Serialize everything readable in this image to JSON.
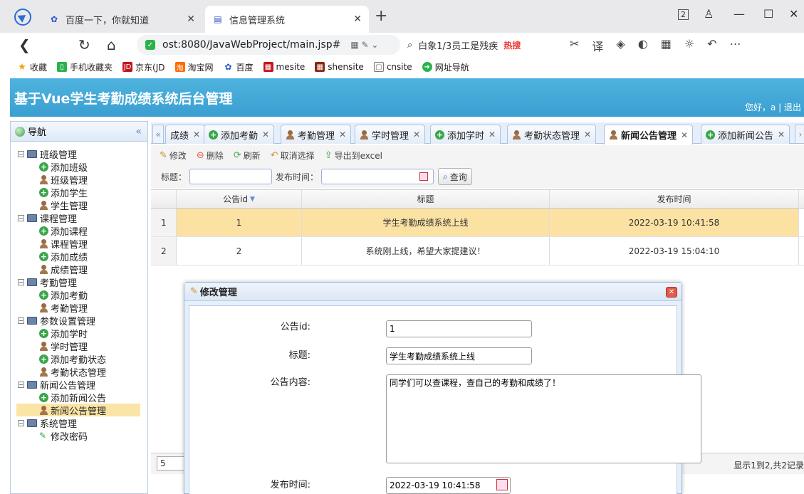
{
  "browser": {
    "tabs": [
      {
        "label": "百度一下，你就知道",
        "active": false
      },
      {
        "label": "信息管理系统",
        "active": true
      }
    ],
    "url": "ost:8080/JavaWebProject/main.jsp#",
    "search_text": "白象1/3员工是残疾",
    "hot_label": "热搜",
    "window_badge": "2",
    "bookmarks": [
      "收藏",
      "手机收藏夹",
      "京东(JD",
      "淘宝网",
      "百度",
      "mesite",
      "shensite",
      "cnsite",
      "网址导航"
    ]
  },
  "app": {
    "title": "基于Vue学生考勤成绩系统后台管理",
    "userinfo": "您好，a | 退出"
  },
  "nav": {
    "header": "导航",
    "groups": [
      {
        "label": "班级管理",
        "items": [
          {
            "label": "添加班级",
            "icon": "plus"
          },
          {
            "label": "班级管理",
            "icon": "user"
          },
          {
            "label": "添加学生",
            "icon": "plus"
          },
          {
            "label": "学生管理",
            "icon": "user"
          }
        ]
      },
      {
        "label": "课程管理",
        "items": [
          {
            "label": "添加课程",
            "icon": "plus"
          },
          {
            "label": "课程管理",
            "icon": "user"
          },
          {
            "label": "添加成绩",
            "icon": "plus"
          },
          {
            "label": "成绩管理",
            "icon": "user"
          }
        ]
      },
      {
        "label": "考勤管理",
        "items": [
          {
            "label": "添加考勤",
            "icon": "plus"
          },
          {
            "label": "考勤管理",
            "icon": "user"
          }
        ]
      },
      {
        "label": "参数设置管理",
        "items": [
          {
            "label": "添加学时",
            "icon": "plus"
          },
          {
            "label": "学时管理",
            "icon": "user"
          },
          {
            "label": "添加考勤状态",
            "icon": "plus"
          },
          {
            "label": "考勤状态管理",
            "icon": "user"
          }
        ]
      },
      {
        "label": "新闻公告管理",
        "items": [
          {
            "label": "添加新闻公告",
            "icon": "plus"
          },
          {
            "label": "新闻公告管理",
            "icon": "user",
            "selected": true
          }
        ]
      },
      {
        "label": "系统管理",
        "items": [
          {
            "label": "修改密码",
            "icon": "pen"
          }
        ]
      }
    ]
  },
  "maintabs": [
    {
      "label": "成绩",
      "icon": "none"
    },
    {
      "label": "添加考勤",
      "icon": "plus"
    },
    {
      "label": "考勤管理",
      "icon": "user"
    },
    {
      "label": "学时管理",
      "icon": "user"
    },
    {
      "label": "添加学时",
      "icon": "plus"
    },
    {
      "label": "考勤状态管理",
      "icon": "user"
    },
    {
      "label": "新闻公告管理",
      "icon": "user",
      "active": true
    },
    {
      "label": "添加新闻公告",
      "icon": "plus"
    }
  ],
  "toolbar": {
    "edit": "修改",
    "delete": "删除",
    "refresh": "刷新",
    "cancel_select": "取消选择",
    "export": "导出到excel"
  },
  "search": {
    "title_label": "标题：",
    "time_label": "发布时间：",
    "query_button": "查询"
  },
  "grid": {
    "columns": [
      "公告id",
      "标题",
      "发布时间"
    ],
    "rows": [
      {
        "num": "1",
        "id": "1",
        "title": "学生考勤成绩系统上线",
        "time": "2022-03-19 10:41:58",
        "selected": true
      },
      {
        "num": "2",
        "id": "2",
        "title": "系统刚上线，希望大家提建议！",
        "time": "2022-03-19 15:04:10",
        "selected": false
      }
    ]
  },
  "pager": {
    "page_size": "5",
    "info": "显示1到2,共2记录"
  },
  "modal": {
    "title": "修改管理",
    "fields": {
      "id_label": "公告id:",
      "id_value": "1",
      "title_label": "标题:",
      "title_value": "学生考勤成绩系统上线",
      "content_label": "公告内容:",
      "content_value": "同学们可以查课程，查自己的考勤和成绩了！",
      "time_label": "发布时间:",
      "time_value": "2022-03-19 10:41:58"
    }
  }
}
